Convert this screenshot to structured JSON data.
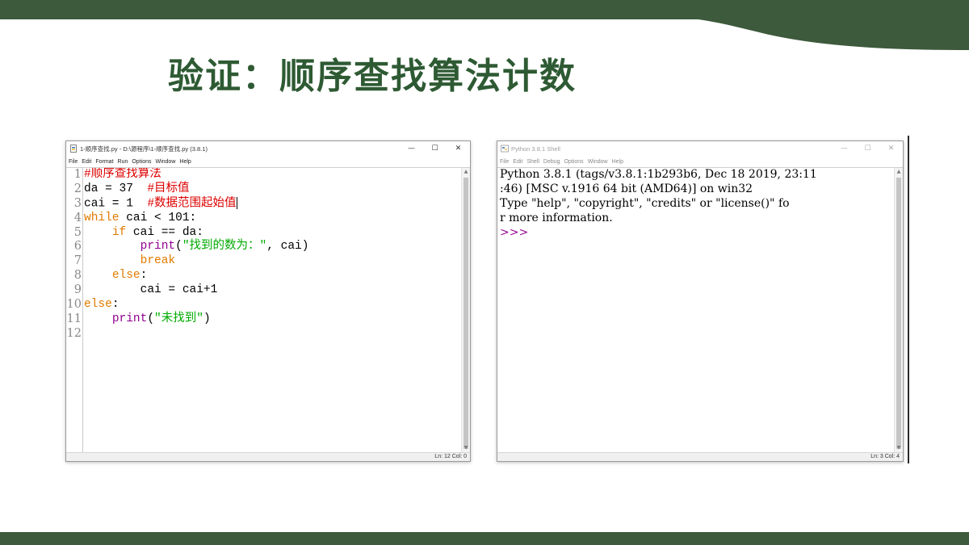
{
  "slide": {
    "title": "验证：顺序查找算法计数",
    "colors": {
      "title": "#2e5a33",
      "band": "#3d5a3c"
    }
  },
  "editor": {
    "title": "1-顺序查找.py - D:\\源程序\\1-顺序查找.py (3.8.1)",
    "menus": [
      "File",
      "Edit",
      "Format",
      "Run",
      "Options",
      "Window",
      "Help"
    ],
    "line_numbers": [
      "1",
      "2",
      "3",
      "4",
      "5",
      "6",
      "7",
      "8",
      "9",
      "10",
      "11",
      "12"
    ],
    "code": {
      "l1": "#顺序查找算法",
      "l2_code": "da = 37  ",
      "l2_comment": "#目标值",
      "l3_code": "cai = 1  ",
      "l3_comment": "#数据范围起始值",
      "l4_kw": "while",
      "l4_rest": " cai < 101:",
      "l5_indent": "    ",
      "l5_kw": "if",
      "l5_rest": " cai == da:",
      "l6_indent": "        ",
      "l6_fn": "print",
      "l6_open": "(",
      "l6_str": "\"找到的数为：\"",
      "l6_rest": ", cai)",
      "l7_indent": "        ",
      "l7_kw": "break",
      "l8_indent": "    ",
      "l8_kw": "else",
      "l8_rest": ":",
      "l9": "        cai = cai+1",
      "l10_kw": "else",
      "l10_rest": ":",
      "l11_indent": "    ",
      "l11_fn": "print",
      "l11_open": "(",
      "l11_str": "\"未找到\"",
      "l11_close": ")",
      "l12": ""
    },
    "status": "Ln: 12   Col: 0",
    "colors": {
      "keyword": "#e17a00",
      "builtin": "#900090",
      "comment": "#dd0000",
      "string": "#00aa00"
    }
  },
  "shell": {
    "title": "Python 3.8.1 Shell",
    "menus": [
      "File",
      "Edit",
      "Shell",
      "Debug",
      "Options",
      "Window",
      "Help"
    ],
    "lines": [
      "Python 3.8.1 (tags/v3.8.1:1b293b6, Dec 18 2019, 23:11",
      ":46) [MSC v.1916 64 bit (AMD64)] on win32",
      "Type \"help\", \"copyright\", \"credits\" or \"license()\" fo",
      "r more information."
    ],
    "prompt": ">>>",
    "status": "Ln: 3   Col: 4"
  },
  "window_controls": {
    "minimize": "—",
    "maximize": "☐",
    "close": "✕"
  },
  "icons": [
    "python-file-icon",
    "python-shell-icon",
    "minimize-icon",
    "maximize-icon",
    "close-icon"
  ]
}
